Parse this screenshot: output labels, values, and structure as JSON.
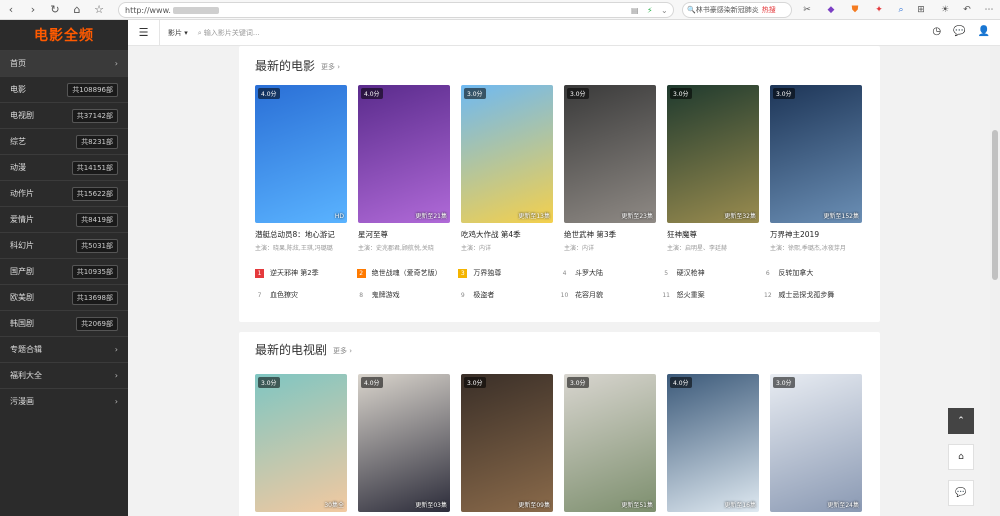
{
  "browser": {
    "url_prefix": "http://www.",
    "search_text": "林书豪感染新冠肺炎",
    "search_hot": "热搜"
  },
  "site": {
    "logo": "电影全频",
    "sidebar": [
      {
        "label": "首页",
        "count": "",
        "arrow": true
      },
      {
        "label": "电影",
        "count": "共108896部",
        "arrow": false
      },
      {
        "label": "电视剧",
        "count": "共37142部",
        "arrow": false
      },
      {
        "label": "综艺",
        "count": "共8231部",
        "arrow": false
      },
      {
        "label": "动漫",
        "count": "共14151部",
        "arrow": false
      },
      {
        "label": "动作片",
        "count": "共15622部",
        "arrow": false
      },
      {
        "label": "爱情片",
        "count": "共8419部",
        "arrow": false
      },
      {
        "label": "科幻片",
        "count": "共5031部",
        "arrow": false
      },
      {
        "label": "国产剧",
        "count": "共10935部",
        "arrow": false
      },
      {
        "label": "欧美剧",
        "count": "共13698部",
        "arrow": false
      },
      {
        "label": "韩国剧",
        "count": "共2069部",
        "arrow": false
      },
      {
        "label": "专题合辑",
        "count": "",
        "arrow": true
      },
      {
        "label": "福利大全",
        "count": "",
        "arrow": true
      },
      {
        "label": "污漫画",
        "count": "",
        "arrow": true
      }
    ],
    "topbar": {
      "type_label": "影片 ▾",
      "search_placeholder": "输入影片关键词..."
    }
  },
  "movies": {
    "title": "最新的电影",
    "more": "更多 ›",
    "cards": [
      {
        "score": "4.0分",
        "status": "HD",
        "title": "潜艇总动员8：地心游记",
        "cast": "主演：晓果,陈炫,王琪,冯璐璐",
        "colors": [
          "#2a6fd6",
          "#5ab3ff"
        ]
      },
      {
        "score": "4.0分",
        "status": "更新至21集",
        "title": "星河至尊",
        "cast": "主演：史兆郡君,顾航悦,关晓",
        "colors": [
          "#5a2b8c",
          "#b06ad8"
        ]
      },
      {
        "score": "3.0分",
        "status": "更新至13集",
        "title": "吃鸡大作战 第4季",
        "cast": "主演：内详",
        "colors": [
          "#6fb9f2",
          "#f4d04c"
        ]
      },
      {
        "score": "3.0分",
        "status": "更新至23集",
        "title": "绝世武神 第3季",
        "cast": "主演：内详",
        "colors": [
          "#3a3a3a",
          "#8f8a85"
        ]
      },
      {
        "score": "3.0分",
        "status": "更新至32集",
        "title": "狂神魔尊",
        "cast": "主演：启明星、李廷赫",
        "colors": [
          "#1f3a2e",
          "#9a8c4f"
        ]
      },
      {
        "score": "3.0分",
        "status": "更新至152集",
        "title": "万界神主2019",
        "cast": "主演：徐熙,季璐杰,冰夜芽月",
        "colors": [
          "#1d3557",
          "#6b8fb5"
        ]
      }
    ],
    "rank": [
      {
        "num": "1",
        "title": "逆天邪神 第2季"
      },
      {
        "num": "2",
        "title": "绝世战魂（爱奇艺版）"
      },
      {
        "num": "3",
        "title": "万界独尊"
      },
      {
        "num": "4",
        "title": "斗罗大陆"
      },
      {
        "num": "5",
        "title": "硬汉枪神"
      },
      {
        "num": "6",
        "title": "反转加拿大"
      },
      {
        "num": "7",
        "title": "血色獠灾"
      },
      {
        "num": "8",
        "title": "鬼牌游戏"
      },
      {
        "num": "9",
        "title": "极盗者"
      },
      {
        "num": "10",
        "title": "花容月貌"
      },
      {
        "num": "11",
        "title": "怒火重案"
      },
      {
        "num": "12",
        "title": "威士忌探戈孤步舞"
      }
    ]
  },
  "tv": {
    "title": "最新的电视剧",
    "more": "更多 ›",
    "cards": [
      {
        "score": "3.0分",
        "status": "30集全",
        "colors": [
          "#7fc6c2",
          "#f2c9a0"
        ]
      },
      {
        "score": "4.0分",
        "status": "更新至03集",
        "colors": [
          "#d9d4cc",
          "#2c2c3a"
        ]
      },
      {
        "score": "3.0分",
        "status": "更新至09集",
        "colors": [
          "#3a2f28",
          "#8a6a4a"
        ]
      },
      {
        "score": "3.0分",
        "status": "更新至51集",
        "colors": [
          "#d8d5cf",
          "#7d8f6e"
        ]
      },
      {
        "score": "4.0分",
        "status": "更新至16集",
        "colors": [
          "#3c5a7a",
          "#dfe9f1"
        ]
      },
      {
        "score": "3.0分",
        "status": "更新至24集",
        "colors": [
          "#e8ecf2",
          "#8a99b3"
        ]
      }
    ]
  }
}
